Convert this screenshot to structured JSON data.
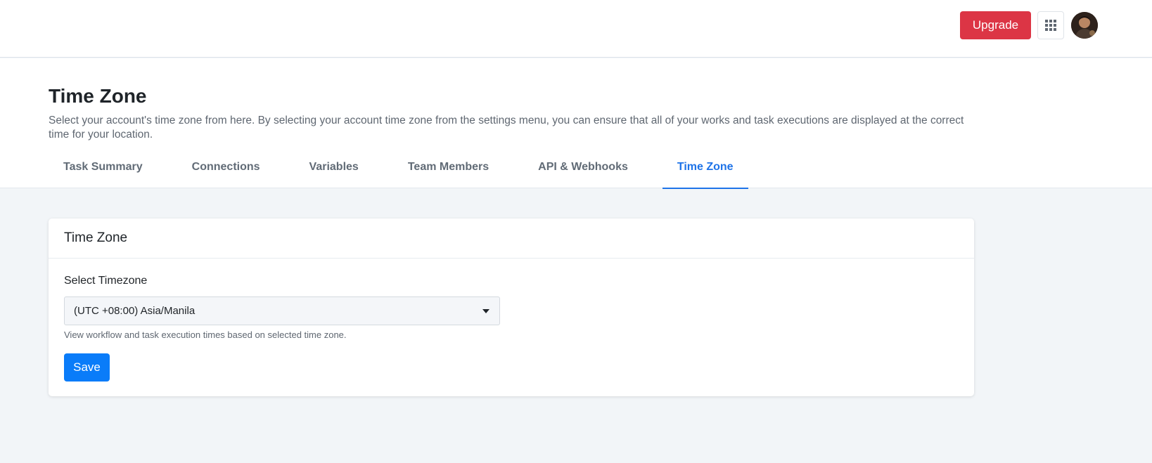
{
  "topbar": {
    "upgrade_label": "Upgrade",
    "apps_icon": "grid-icon",
    "avatar_icon": "user-avatar"
  },
  "header": {
    "title": "Time Zone",
    "description": "Select your account's time zone from here. By selecting your account time zone from the settings menu, you can ensure that all of your works and task executions are displayed at the correct time for your location."
  },
  "tabs": [
    {
      "label": "Task Summary",
      "active": false
    },
    {
      "label": "Connections",
      "active": false
    },
    {
      "label": "Variables",
      "active": false
    },
    {
      "label": "Team Members",
      "active": false
    },
    {
      "label": "API & Webhooks",
      "active": false
    },
    {
      "label": "Time Zone",
      "active": true
    }
  ],
  "card": {
    "title": "Time Zone",
    "field_label": "Select Timezone",
    "selected_timezone": "(UTC +08:00) Asia/Manila",
    "help_text": "View workflow and task execution times based on selected time zone.",
    "save_label": "Save"
  },
  "colors": {
    "upgrade": "#dc3545",
    "save": "#0a7cf9",
    "active_tab": "#1e73e8",
    "page_bg": "#f2f5f8"
  }
}
